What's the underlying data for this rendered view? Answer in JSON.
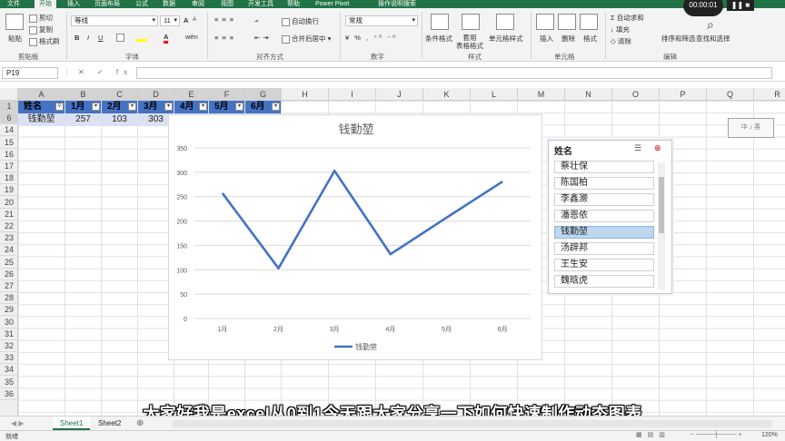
{
  "ribbon_tabs": [
    "文件",
    "开始",
    "插入",
    "页面布局",
    "公式",
    "数据",
    "审阅",
    "视图",
    "开发工具",
    "帮助",
    "Power Pivot",
    "操作说明搜索"
  ],
  "ribbon": {
    "clipboard": {
      "paste": "粘贴",
      "cut": "剪切",
      "copy": "复制",
      "format_painter": "格式刷",
      "label": "剪贴板"
    },
    "font": {
      "name": "等线",
      "size": "11",
      "bold": "B",
      "italic": "I",
      "underline": "U",
      "grow": "A",
      "shrink": "A",
      "color": "A",
      "phonetic": "wén",
      "label": "字体"
    },
    "alignment": {
      "wrap": "自动换行",
      "merge": "合并后居中",
      "label": "对齐方式"
    },
    "number": {
      "format": "常规",
      "label": "数字"
    },
    "styles": {
      "conditional": "条件格式",
      "table": "套用\n表格格式",
      "cell": "单元格样式",
      "label": "样式"
    },
    "cells": {
      "insert": "插入",
      "delete": "删除",
      "format": "格式",
      "label": "单元格"
    },
    "editing": {
      "autosum": "自动求和",
      "fill": "填充",
      "clear": "清除",
      "sort": "排序和筛选",
      "find": "查找和选择",
      "label": "编辑"
    }
  },
  "recorder": {
    "time": "00:00:01",
    "pause": "❚❚ ■"
  },
  "formula_bar": {
    "name_box": "P19",
    "buttons": "✕ ✓ fx",
    "value": ""
  },
  "columns": [
    "A",
    "B",
    "C",
    "D",
    "E",
    "F",
    "G",
    "H",
    "I",
    "J",
    "K",
    "L",
    "M",
    "N",
    "O",
    "P",
    "Q",
    "R"
  ],
  "rows": [
    "1",
    "6",
    "14",
    "15",
    "16",
    "17",
    "18",
    "19",
    "20",
    "21",
    "22",
    "23",
    "24",
    "25",
    "26",
    "27",
    "28",
    "29",
    "30",
    "31",
    "32",
    "33",
    "34",
    "35",
    "36"
  ],
  "table": {
    "headers": [
      "姓名",
      "1月",
      "2月",
      "3月",
      "4月",
      "5月",
      "6月"
    ],
    "row": [
      "钱勤堃",
      "257",
      "103",
      "303"
    ]
  },
  "chart_data": {
    "type": "line",
    "title": "钱勤堃",
    "categories": [
      "1月",
      "2月",
      "3月",
      "4月",
      "5月",
      "6月"
    ],
    "series": [
      {
        "name": "钱勤堃",
        "values": [
          257,
          103,
          303,
          132,
          207,
          281
        ],
        "color": "#4472c4"
      }
    ],
    "ylim": [
      0,
      350
    ],
    "yticks": [
      "0",
      "50",
      "100",
      "150",
      "200",
      "250",
      "300",
      "350"
    ],
    "legend": "bottom",
    "grid": true
  },
  "slicer": {
    "title": "姓名",
    "items": [
      "蔡壮保",
      "陈国柏",
      "李鑫灏",
      "潘恩依",
      "钱勤堃",
      "汤辟邦",
      "王生安",
      "魏晗虎"
    ],
    "selected_index": 4
  },
  "float_box": {
    "text": "中 ♪ 英"
  },
  "subtitle": "大家好我是excel从0到1今天跟大家分享一下如何快速制作动态图表",
  "sheets": [
    "Sheet1",
    "Sheet2"
  ],
  "add_sheet": "⊕",
  "status": {
    "ready": "就绪",
    "zoom": "120%"
  }
}
